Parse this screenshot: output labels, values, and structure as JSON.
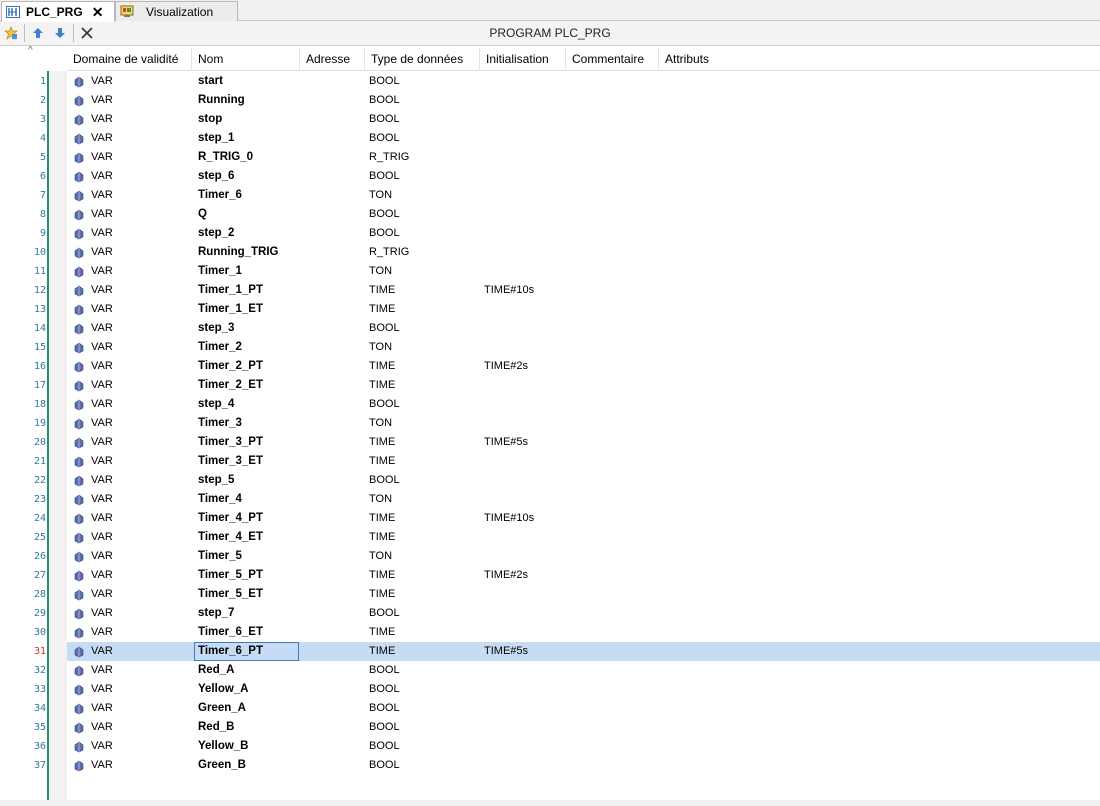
{
  "tabs": [
    {
      "label": "PLC_PRG",
      "icon": "plc-prg-icon",
      "active": true
    },
    {
      "label": "Visualization",
      "icon": "visualization-icon",
      "active": false
    }
  ],
  "toolbar": {
    "title": "PROGRAM PLC_PRG",
    "buttons": [
      "insert-variable-icon",
      "move-up-icon",
      "move-down-icon",
      "delete-icon"
    ]
  },
  "columns": [
    "Domaine de validité",
    "Nom",
    "Adresse",
    "Type de données",
    "Initialisation",
    "Commentaire",
    "Attributs"
  ],
  "selected_line": 31,
  "rows": [
    {
      "line": "1",
      "scope": "VAR",
      "name": "start",
      "type": "BOOL",
      "init": ""
    },
    {
      "line": "2",
      "scope": "VAR",
      "name": "Running",
      "type": "BOOL",
      "init": ""
    },
    {
      "line": "3",
      "scope": "VAR",
      "name": "stop",
      "type": "BOOL",
      "init": ""
    },
    {
      "line": "4",
      "scope": "VAR",
      "name": "step_1",
      "type": "BOOL",
      "init": ""
    },
    {
      "line": "5",
      "scope": "VAR",
      "name": "R_TRIG_0",
      "type": "R_TRIG",
      "init": ""
    },
    {
      "line": "6",
      "scope": "VAR",
      "name": "step_6",
      "type": "BOOL",
      "init": ""
    },
    {
      "line": "7",
      "scope": "VAR",
      "name": "Timer_6",
      "type": "TON",
      "init": ""
    },
    {
      "line": "8",
      "scope": "VAR",
      "name": "Q",
      "type": "BOOL",
      "init": ""
    },
    {
      "line": "9",
      "scope": "VAR",
      "name": "step_2",
      "type": "BOOL",
      "init": ""
    },
    {
      "line": "10",
      "scope": "VAR",
      "name": "Running_TRIG",
      "type": "R_TRIG",
      "init": ""
    },
    {
      "line": "11",
      "scope": "VAR",
      "name": "Timer_1",
      "type": "TON",
      "init": ""
    },
    {
      "line": "12",
      "scope": "VAR",
      "name": "Timer_1_PT",
      "type": "TIME",
      "init": "TIME#10s"
    },
    {
      "line": "13",
      "scope": "VAR",
      "name": "Timer_1_ET",
      "type": "TIME",
      "init": ""
    },
    {
      "line": "14",
      "scope": "VAR",
      "name": "step_3",
      "type": "BOOL",
      "init": ""
    },
    {
      "line": "15",
      "scope": "VAR",
      "name": "Timer_2",
      "type": "TON",
      "init": ""
    },
    {
      "line": "16",
      "scope": "VAR",
      "name": "Timer_2_PT",
      "type": "TIME",
      "init": "TIME#2s"
    },
    {
      "line": "17",
      "scope": "VAR",
      "name": "Timer_2_ET",
      "type": "TIME",
      "init": ""
    },
    {
      "line": "18",
      "scope": "VAR",
      "name": "step_4",
      "type": "BOOL",
      "init": ""
    },
    {
      "line": "19",
      "scope": "VAR",
      "name": "Timer_3",
      "type": "TON",
      "init": ""
    },
    {
      "line": "20",
      "scope": "VAR",
      "name": "Timer_3_PT",
      "type": "TIME",
      "init": "TIME#5s"
    },
    {
      "line": "21",
      "scope": "VAR",
      "name": "Timer_3_ET",
      "type": "TIME",
      "init": ""
    },
    {
      "line": "22",
      "scope": "VAR",
      "name": "step_5",
      "type": "BOOL",
      "init": ""
    },
    {
      "line": "23",
      "scope": "VAR",
      "name": "Timer_4",
      "type": "TON",
      "init": ""
    },
    {
      "line": "24",
      "scope": "VAR",
      "name": "Timer_4_PT",
      "type": "TIME",
      "init": "TIME#10s"
    },
    {
      "line": "25",
      "scope": "VAR",
      "name": "Timer_4_ET",
      "type": "TIME",
      "init": ""
    },
    {
      "line": "26",
      "scope": "VAR",
      "name": "Timer_5",
      "type": "TON",
      "init": ""
    },
    {
      "line": "27",
      "scope": "VAR",
      "name": "Timer_5_PT",
      "type": "TIME",
      "init": "TIME#2s"
    },
    {
      "line": "28",
      "scope": "VAR",
      "name": "Timer_5_ET",
      "type": "TIME",
      "init": ""
    },
    {
      "line": "29",
      "scope": "VAR",
      "name": "step_7",
      "type": "BOOL",
      "init": ""
    },
    {
      "line": "30",
      "scope": "VAR",
      "name": "Timer_6_ET",
      "type": "TIME",
      "init": ""
    },
    {
      "line": "31",
      "scope": "VAR",
      "name": "Timer_6_PT",
      "type": "TIME",
      "init": "TIME#5s"
    },
    {
      "line": "32",
      "scope": "VAR",
      "name": "Red_A",
      "type": "BOOL",
      "init": ""
    },
    {
      "line": "33",
      "scope": "VAR",
      "name": "Yellow_A",
      "type": "BOOL",
      "init": ""
    },
    {
      "line": "34",
      "scope": "VAR",
      "name": "Green_A",
      "type": "BOOL",
      "init": ""
    },
    {
      "line": "35",
      "scope": "VAR",
      "name": "Red_B",
      "type": "BOOL",
      "init": ""
    },
    {
      "line": "36",
      "scope": "VAR",
      "name": "Yellow_B",
      "type": "BOOL",
      "init": ""
    },
    {
      "line": "37",
      "scope": "VAR",
      "name": "Green_B",
      "type": "BOOL",
      "init": ""
    }
  ],
  "colors": {
    "selection": "#c5dcf4",
    "line_number": "#2b7a9c",
    "active_line_number": "#c0392b",
    "gutter_line": "#2a8a7a"
  }
}
